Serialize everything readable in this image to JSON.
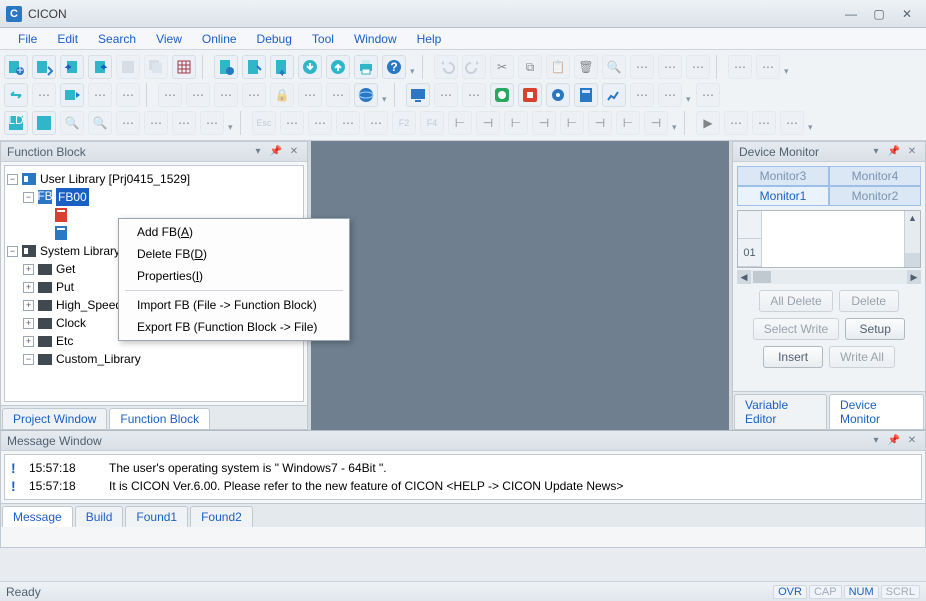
{
  "window": {
    "title": "CICON"
  },
  "menu": [
    "File",
    "Edit",
    "Search",
    "View",
    "Online",
    "Debug",
    "Tool",
    "Window",
    "Help"
  ],
  "panels": {
    "left_title": "Function Block",
    "right_title": "Device Monitor",
    "msg_title": "Message Window"
  },
  "tree": {
    "root": "User Library [Prj0415_1529]",
    "fb_selected": "FB00",
    "system": "System Library",
    "items": [
      "Get",
      "Put",
      "High_Speed_Counter",
      "Clock",
      "Etc",
      "Custom_Library"
    ]
  },
  "left_tabs": {
    "project": "Project Window",
    "fb": "Function Block"
  },
  "context_menu": {
    "add": "Add FB(",
    "add_k": "A",
    "add_end": ")",
    "del": "Delete FB(",
    "del_k": "D",
    "del_end": ")",
    "prop": "Properties(",
    "prop_k": "I",
    "prop_end": ")",
    "import": "Import FB (File -> Function Block)",
    "export": "Export FB (Function Block -> File)"
  },
  "monitor": {
    "tabs": [
      "Monitor3",
      "Monitor4",
      "Monitor1",
      "Monitor2"
    ],
    "row_label": "01",
    "buttons": {
      "all_delete": "All Delete",
      "delete": "Delete",
      "select_write": "Select Write",
      "setup": "Setup",
      "insert": "Insert",
      "write_all": "Write All"
    },
    "bottom_tabs": {
      "var": "Variable Editor",
      "dev": "Device Monitor"
    }
  },
  "messages": [
    {
      "time": "15:57:18",
      "text": "The user's operating system is \" Windows7 - 64Bit \"."
    },
    {
      "time": "15:57:18",
      "text": "It is CICON Ver.6.00. Please refer to the new feature of CICON <HELP -> CICON Update News>"
    }
  ],
  "msg_tabs": [
    "Message",
    "Build",
    "Found1",
    "Found2"
  ],
  "status": {
    "ready": "Ready",
    "cells": [
      "OVR",
      "CAP",
      "NUM",
      "SCRL"
    ]
  }
}
